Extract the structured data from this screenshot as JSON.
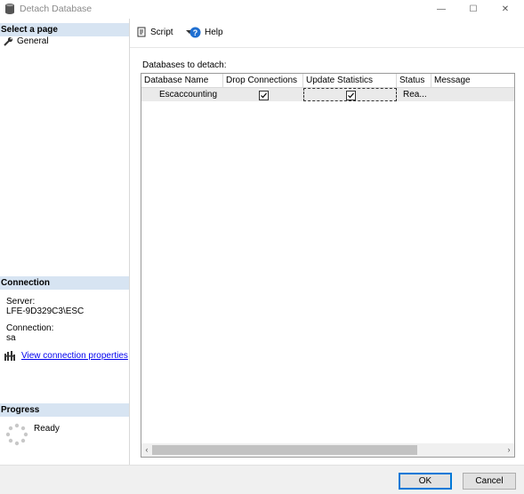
{
  "window": {
    "title": "Detach Database",
    "minimize": "—",
    "maximize": "☐",
    "close": "✕"
  },
  "left": {
    "select_page_header": "Select a page",
    "pages": [
      {
        "label": "General"
      }
    ],
    "connection_header": "Connection",
    "server_label": "Server:",
    "server_value": "LFE-9D329C3\\ESC",
    "connection_label": "Connection:",
    "connection_value": "sa",
    "view_props_link": "View connection properties",
    "progress_header": "Progress",
    "progress_status": "Ready"
  },
  "toolbar": {
    "script_label": "Script",
    "help_label": "Help"
  },
  "main": {
    "databases_label": "Databases to detach:",
    "columns": [
      "Database Name",
      "Drop Connections",
      "Update Statistics",
      "Status",
      "Message"
    ],
    "rows": [
      {
        "database_name": "Escaccounting",
        "drop_connections": true,
        "update_statistics": true,
        "status": "Rea...",
        "message": ""
      }
    ]
  },
  "buttons": {
    "ok": "OK",
    "cancel": "Cancel"
  }
}
